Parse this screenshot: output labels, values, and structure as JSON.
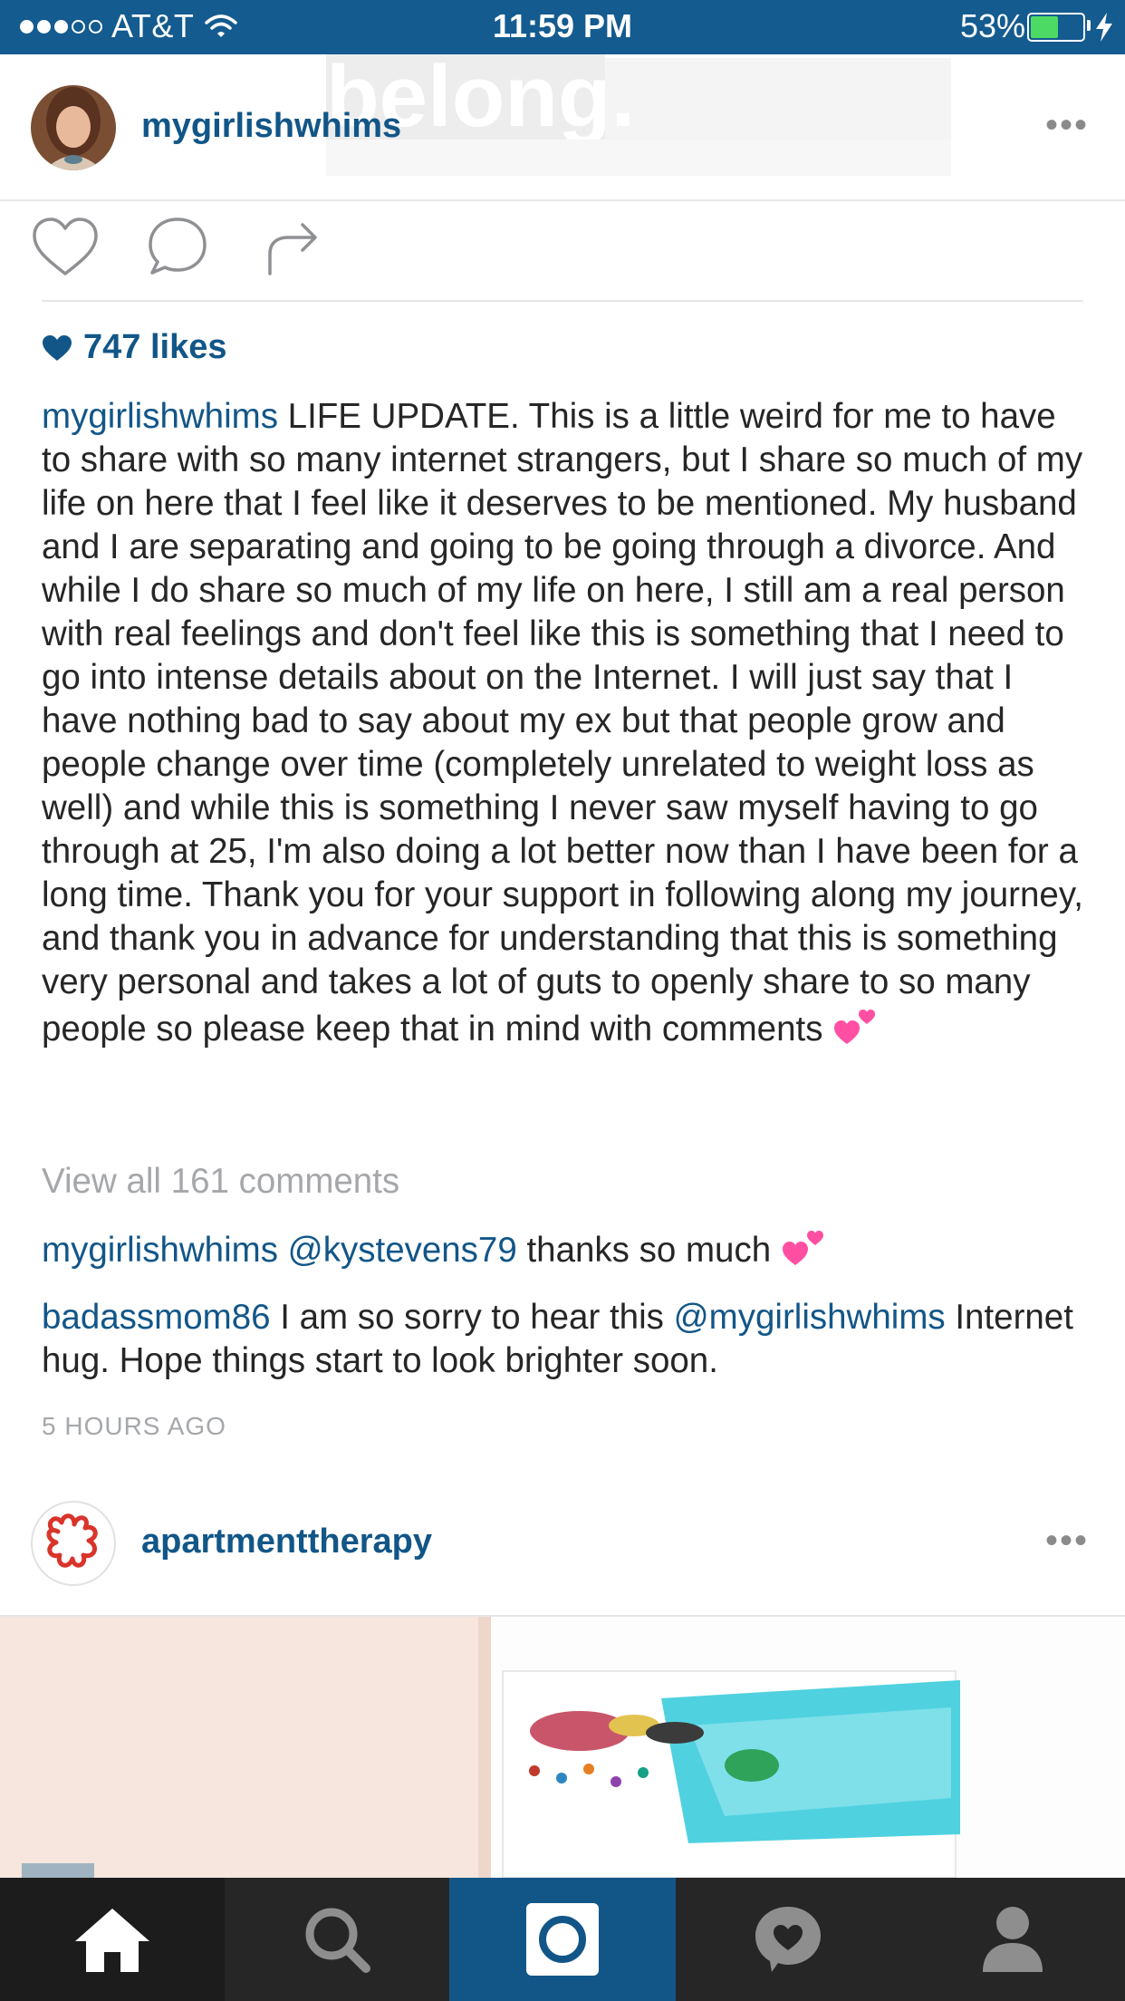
{
  "status_bar": {
    "carrier": "AT&T",
    "time": "11:59 PM",
    "battery_percent": "53%",
    "battery_level": 0.53
  },
  "post1": {
    "username": "mygirlishwhims",
    "overlay_text": "belong.",
    "likes": "747 likes",
    "caption_username": "mygirlishwhims",
    "caption_text": "LIFE UPDATE. This is a little weird for me to have to share with so many internet strangers, but I share so much of my life on here that I feel like it deserves to be mentioned. My husband and I are separating and going to be going through a divorce. And while I do share so much of my life on here, I still am a real person with real feelings and don't feel like this is something that I need to go into intense details about on the Internet. I will just say that I have nothing bad to say about my ex but that people grow and people change over time (completely unrelated to weight loss as well) and while this is something I never saw myself having to go through at 25, I'm also doing a lot better now than I have been for a long time. Thank you for your support in following along my journey, and thank you in advance for understanding that this is something very personal and takes a lot of guts to openly share to so many people so please keep that in mind with comments",
    "view_all": "View all 161 comments",
    "comments": [
      {
        "username": "mygirlishwhims",
        "mention": "@kystevens79",
        "text": "thanks so much"
      },
      {
        "username": "badassmom86",
        "text_before": "I am so sorry to hear this",
        "mention": "@mygirlishwhims",
        "text_after": "Internet hug. Hope things start to look brighter soon."
      }
    ],
    "timestamp": "5 HOURS AGO"
  },
  "post2": {
    "username": "apartmenttherapy"
  },
  "nav": {
    "items": [
      "home-icon",
      "search-icon",
      "camera-icon",
      "activity-icon",
      "profile-icon"
    ],
    "active_color": "#125688"
  },
  "colors": {
    "accent": "#125688",
    "status_bar": "#145b8f",
    "battery": "#4cd964",
    "nav_bg": "#262626",
    "heart_emoji": "#ff4fa3"
  }
}
